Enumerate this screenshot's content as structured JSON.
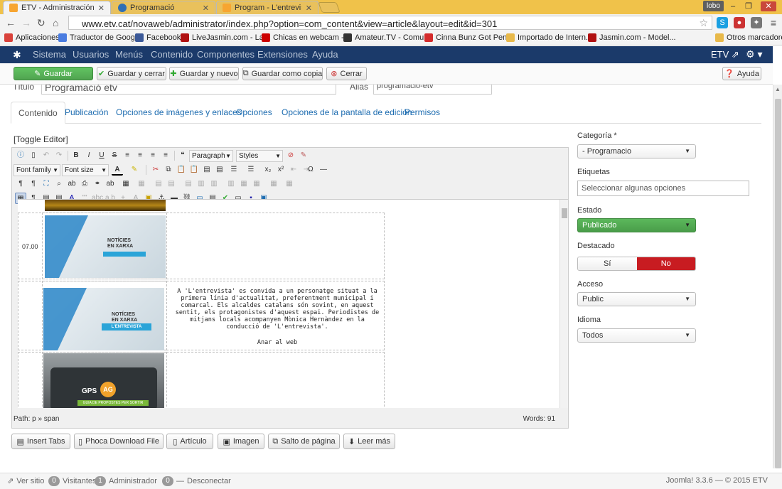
{
  "browser": {
    "tabs": [
      {
        "label": "ETV - Administración - G",
        "active": true,
        "fav_color": "#f7a531"
      },
      {
        "label": "Programació",
        "active": false,
        "fav_color": "#2f6fb5"
      },
      {
        "label": "Program - L'entrevista",
        "active": false,
        "fav_color": "#f7a531"
      }
    ],
    "user": "lobo",
    "url": "www.etv.cat/novaweb/administrator/index.php?option=com_content&view=article&layout=edit&id=301",
    "bookmarks": [
      {
        "label": "Aplicaciones",
        "color": "#d9423b"
      },
      {
        "label": "Traductor de Google",
        "color": "#4a7ce0"
      },
      {
        "label": "Facebook",
        "color": "#3b5998"
      },
      {
        "label": "LiveJasmin.com - La...",
        "color": "#b01010"
      },
      {
        "label": "Chicas en webcam -...",
        "color": "#c00"
      },
      {
        "label": "Amateur.TV - Comu...",
        "color": "#333"
      },
      {
        "label": "Cinna Bunz Got Pen...",
        "color": "#d42b2b"
      },
      {
        "label": "Importado de Intern...",
        "color": "#e8b94a"
      },
      {
        "label": "Jasmin.com - Model...",
        "color": "#b01010"
      },
      {
        "label": "Otros marcadores",
        "color": "#e8b94a"
      }
    ]
  },
  "joomla_nav": {
    "items": [
      "Sistema",
      "Usuarios",
      "Menús",
      "Contenido",
      "Componentes",
      "Extensiones",
      "Ayuda"
    ],
    "site": "ETV",
    "site_icon": "external-link-icon"
  },
  "actions": {
    "save": "Guardar",
    "save_close": "Guardar y cerrar",
    "save_new": "Guardar y nuevo",
    "save_copy": "Guardar como copia",
    "close": "Cerrar",
    "help": "Ayuda"
  },
  "article": {
    "title_label": "Título",
    "title_value": "Programació etv",
    "alias_label": "Alias",
    "alias_value": "programacio-etv"
  },
  "edit_tabs": [
    "Contenido",
    "Publicación",
    "Opciones de imágenes y enlaces",
    "Opciones",
    "Opciones de la pantalla de edición",
    "Permisos"
  ],
  "editor": {
    "toggle_label": "[Toggle Editor]",
    "format_select": "Paragraph",
    "styles_select": "Styles",
    "font_family": "Font family",
    "font_size": "Font size",
    "time_label": "07.00",
    "image1_line1": "NOTÍCIES",
    "image1_line2": "EN XARXA",
    "image2_line1": "NOTÍCIES",
    "image2_line2": "EN XARXA",
    "image2_banner": "L'ENTREVISTA",
    "image3_title": "GPS",
    "image3_badge": "AG",
    "image3_banner": "GUIA DE PROPOSTES PER SORTIR",
    "description": "A 'L'entrevista' es convida a un personatge situat a la primera línia d'actualitat, preferentment municipal i comarcal. Els alcaldes catalans són sovint, en aquest sentit, els protagonistes d'aquest espai. Periodistes de mitjans locals acompanyen Mònica Hernàndez en la conducció de 'L'entrevista'.",
    "link_text": "Anar al web",
    "path": "Path:  p » span",
    "words": "Words: 91"
  },
  "extra_buttons": [
    "Insert Tabs",
    "Phoca Download File",
    "Artículo",
    "Imagen",
    "Salto de página",
    "Leer más"
  ],
  "sidebar": {
    "category_label": "Categoría *",
    "category_value": "- Programacio",
    "tags_label": "Etiquetas",
    "tags_placeholder": "Seleccionar algunas opciones",
    "state_label": "Estado",
    "state_value": "Publicado",
    "featured_label": "Destacado",
    "featured_yes": "Sí",
    "featured_no": "No",
    "access_label": "Acceso",
    "access_value": "Public",
    "language_label": "Idioma",
    "language_value": "Todos"
  },
  "footer": {
    "view_site": "Ver sitio",
    "visitors_count": "0",
    "visitors_label": "Visitantes",
    "admin_count": "1",
    "admin_label": "Administrador",
    "logout_count": "0",
    "logout_label": "Desconectar",
    "copyright": "Joomla! 3.3.6 — © 2015 ETV"
  },
  "colors": {
    "nav_bg": "#1b3a6a",
    "success": "#51a351",
    "danger": "#c81c21",
    "link": "#1d6cb0"
  }
}
